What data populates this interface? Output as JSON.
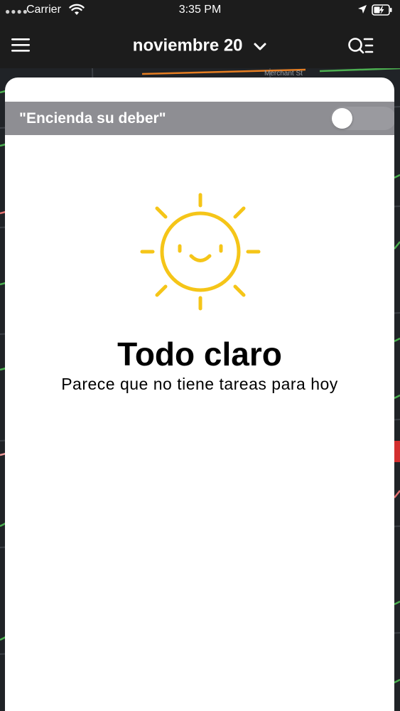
{
  "status_bar": {
    "carrier": "Carrier",
    "time": "3:35 PM",
    "icons": [
      "signal-dots-icon",
      "wifi-icon",
      "location-arrow-icon",
      "battery-charging-icon"
    ]
  },
  "nav": {
    "title": "noviembre 20",
    "icons": [
      "hamburger-menu-icon",
      "chevron-down-icon",
      "search-list-icon"
    ]
  },
  "duty": {
    "label": "\"Encienda su deber\"",
    "toggle_on": false
  },
  "empty_state": {
    "icon": "smiling-sun-icon",
    "title": "Todo claro",
    "subtitle": "Parece que no tiene tareas para hoy"
  },
  "map": {
    "street_labels": [
      "Merchant St"
    ]
  },
  "colors": {
    "sun": "#f5c518",
    "duty_bar": "#8e8e93",
    "nav_bg": "#1c1c1c",
    "card_bg": "#ffffff"
  }
}
